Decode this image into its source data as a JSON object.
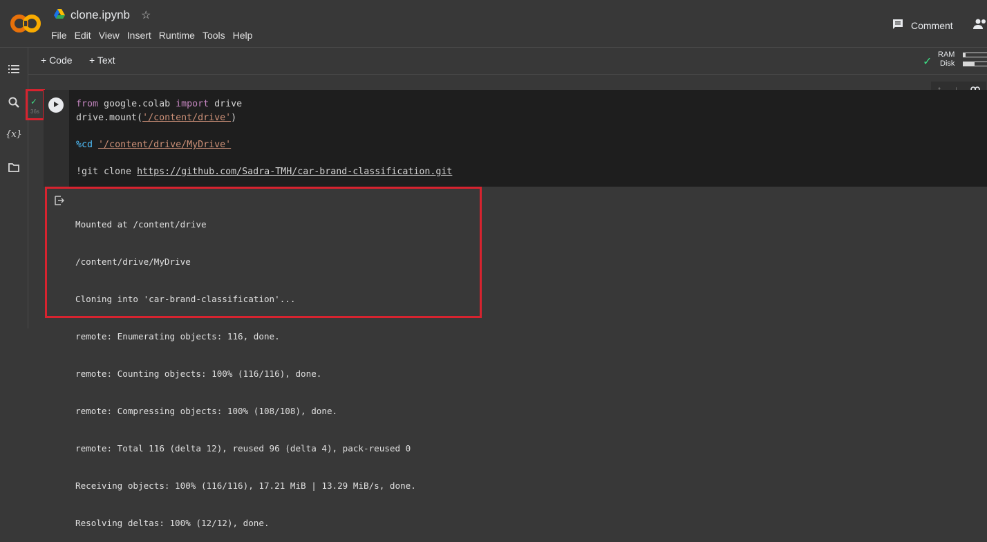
{
  "header": {
    "logo": "CO",
    "title": "clone.ipynb",
    "drive_icon": "google-drive-icon",
    "star_icon": "☆",
    "menu": [
      "File",
      "Edit",
      "View",
      "Insert",
      "Runtime",
      "Tools",
      "Help"
    ],
    "comment_label": "Comment"
  },
  "sidebar": {
    "icons": [
      "table-of-contents-icon",
      "search-icon",
      "variables-icon",
      "folder-icon"
    ],
    "variables_label": "{x}"
  },
  "toolbar": {
    "add_code": "+ Code",
    "add_text": "+ Text",
    "ram_label": "RAM",
    "disk_label": "Disk"
  },
  "cell": {
    "exec_time": "36s",
    "code": {
      "line1_kw1": "from",
      "line1_mod": " google.colab ",
      "line1_kw2": "import",
      "line1_name": " drive",
      "line2_pre": "drive.mount(",
      "line2_str": "'/content/drive'",
      "line2_post": ")",
      "line3_magic": "%cd",
      "line3_str": "'/content/drive/MyDrive'",
      "line4_pre": "!git clone ",
      "line4_url": "https://github.com/Sadra-TMH/car-brand-classification.git"
    },
    "output": [
      "Mounted at /content/drive",
      "/content/drive/MyDrive",
      "Cloning into 'car-brand-classification'...",
      "remote: Enumerating objects: 116, done.",
      "remote: Counting objects: 100% (116/116), done.",
      "remote: Compressing objects: 100% (108/108), done.",
      "remote: Total 116 (delta 12), reused 96 (delta 4), pack-reused 0",
      "Receiving objects: 100% (116/116), 17.21 MiB | 13.29 MiB/s, done.",
      "Resolving deltas: 100% (12/12), done."
    ]
  },
  "colors": {
    "accent_orange": "#f9ab00",
    "check_green": "#3ddc84",
    "highlight_red": "#d7232f"
  }
}
